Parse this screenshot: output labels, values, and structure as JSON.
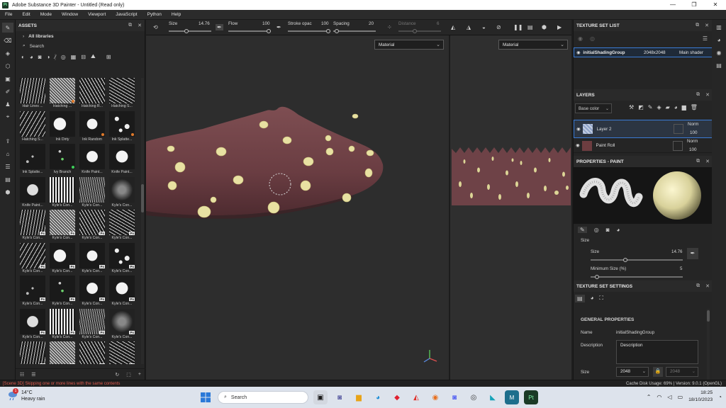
{
  "titlebar": {
    "app_icon_text": "Pt",
    "title": "Adobe Substance 3D Painter - Untitled (Read only)",
    "controls": [
      "—",
      "❐",
      "✕"
    ]
  },
  "menu": [
    "File",
    "Edit",
    "Mode",
    "Window",
    "Viewport",
    "JavaScript",
    "Python",
    "Help"
  ],
  "assets": {
    "header": "ASSETS",
    "library": "All libraries",
    "search_placeholder": "Search",
    "items": [
      {
        "label": "Hair Lines ..."
      },
      {
        "label": "Hatching ..."
      },
      {
        "label": "Hatching R..."
      },
      {
        "label": "Hatching S..."
      },
      {
        "label": "Hatching S..."
      },
      {
        "label": "Ink Dirty"
      },
      {
        "label": "Ink Random"
      },
      {
        "label": "Ink Splatte..."
      },
      {
        "label": "Ink Splatte..."
      },
      {
        "label": "Ivy Branch"
      },
      {
        "label": "Knife Paint..."
      },
      {
        "label": "Knife Paint..."
      },
      {
        "label": "Knife Paint..."
      },
      {
        "label": "Kyle's Con..."
      },
      {
        "label": "Kyle's Con..."
      },
      {
        "label": "Kyle's Con..."
      },
      {
        "label": "Kyle's Con..."
      },
      {
        "label": "Kyle's Con..."
      },
      {
        "label": "Kyle's Con..."
      },
      {
        "label": "Kyle's Con..."
      },
      {
        "label": "Kyle's Con..."
      },
      {
        "label": "Kyle's Con..."
      },
      {
        "label": "Kyle's Con..."
      },
      {
        "label": "Kyle's Con..."
      },
      {
        "label": "Kyle's Con..."
      },
      {
        "label": "Kyle's Con..."
      },
      {
        "label": "Kyle's Con..."
      },
      {
        "label": "Kyle's Con..."
      },
      {
        "label": "Kyle's Con..."
      },
      {
        "label": "Kyle's Con..."
      },
      {
        "label": "Kyle's Con..."
      },
      {
        "label": "Kyle's Con..."
      },
      {
        "label": "Kyle's Con..."
      },
      {
        "label": "Kyle's Con..."
      },
      {
        "label": "Kyle's Con..."
      },
      {
        "label": "Kyle's Con..."
      }
    ]
  },
  "tool_options": {
    "size_label": "Size",
    "size_value": "14.76",
    "flow_label": "Flow",
    "flow_value": "100",
    "stroke_label": "Stroke opac",
    "stroke_value": "100",
    "spacing_label": "Spacing",
    "spacing_value": "20",
    "distance_label": "Distance",
    "distance_value": "6"
  },
  "viewport3d": {
    "mode": "Material"
  },
  "viewport2d": {
    "mode": "Material"
  },
  "texture_set_list": {
    "header": "TEXTURE SET LIST",
    "item_name": "initialShadingGroup",
    "item_res": "2048x2048",
    "item_shader": "Main shader"
  },
  "layers": {
    "header": "LAYERS",
    "channel": "Base color",
    "items": [
      {
        "name": "Layer 2",
        "blend": "Norm",
        "opacity": "100"
      },
      {
        "name": "Paint Roll",
        "blend": "Norm",
        "opacity": "100"
      }
    ]
  },
  "properties_paint": {
    "header": "PROPERTIES - PAINT",
    "section": "Size",
    "size_label": "Size",
    "size_value": "14.76",
    "min_size_label": "Minimum Size (%)",
    "min_size_value": "5"
  },
  "texture_set_settings": {
    "header": "TEXTURE SET SETTINGS",
    "section": "GENERAL PROPERTIES",
    "name_label": "Name",
    "name_value": "initialShadingGroup",
    "description_label": "Description",
    "description_value": "Description",
    "size_label": "Size",
    "size_value": "2048",
    "size_value2": "2048"
  },
  "statusbar": {
    "message": "[Scene 3D] Skipping one or more lines with the same contents",
    "info": "Cache Disk Usage:   69% | Version: 9.0.1 (OpenGL)"
  },
  "taskbar": {
    "temp": "14°C",
    "weather": "Heavy rain",
    "badge": "1",
    "search_placeholder": "Search",
    "time": "18:25",
    "date": "18/10/2023"
  }
}
